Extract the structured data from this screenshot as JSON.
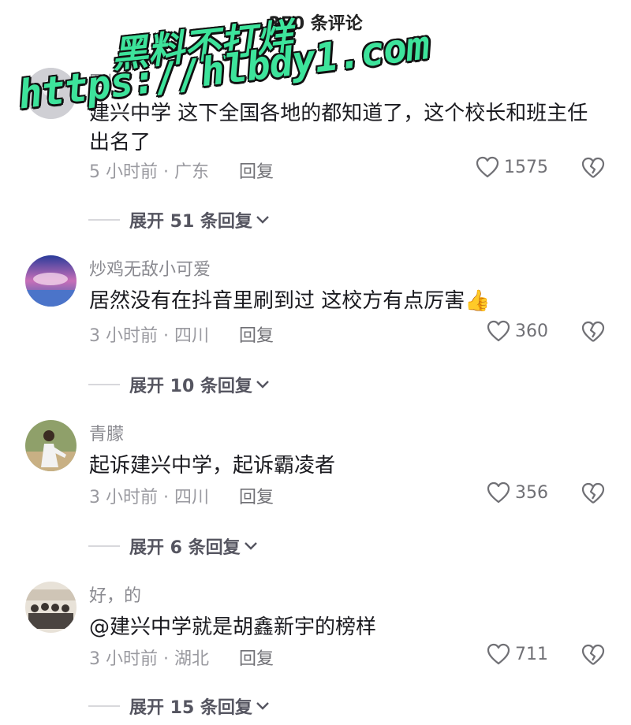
{
  "header": {
    "title": "350 条评论"
  },
  "watermark": {
    "line1": "黑料不打烊",
    "line2": "https://hlbdy1.com"
  },
  "comments": [
    {
      "username": "四川",
      "text": "建兴中学 这下全国各地的都知道了，这个校长和班主任出名了",
      "meta": "5 小时前 · 广东",
      "reply_label": "回复",
      "likes": "1575",
      "expand_label": "展开 51 条回复",
      "avatar_icon": "default-avatar-icon"
    },
    {
      "username": "炒鸡无敌小可爱",
      "text": "居然没有在抖音里刷到过  这校方有点厉害👍",
      "meta": "3 小时前 · 四川",
      "reply_label": "回复",
      "likes": "360",
      "expand_label": "展开 10 条回复",
      "avatar_icon": "sky-avatar-icon"
    },
    {
      "username": "青朦",
      "text": "起诉建兴中学，起诉霸凌者",
      "meta": "3 小时前 · 四川",
      "reply_label": "回复",
      "likes": "356",
      "expand_label": "展开 6 条回复",
      "avatar_icon": "person-avatar-icon"
    },
    {
      "username": "好，的",
      "text": "@建兴中学就是胡鑫新宇的榜样",
      "meta": "3 小时前 · 湖北",
      "reply_label": "回复",
      "likes": "711",
      "expand_label": "展开 15 条回复",
      "avatar_icon": "group-avatar-icon"
    }
  ]
}
